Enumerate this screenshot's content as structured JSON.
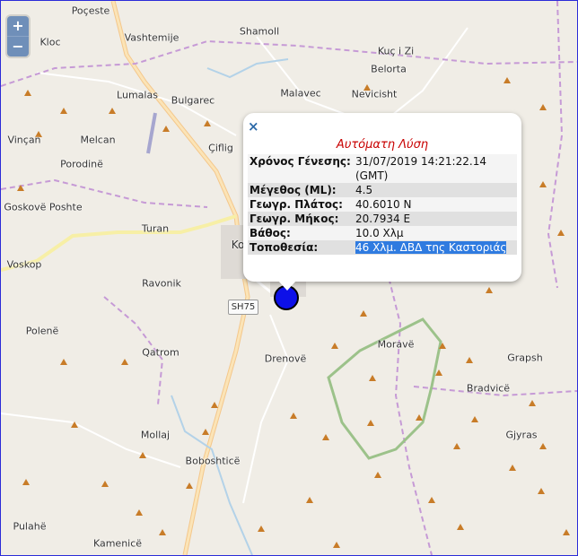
{
  "zoom": {
    "in_label": "+",
    "out_label": "−"
  },
  "road_shield": "SH75",
  "places": [
    {
      "id": "poceste",
      "label": "Poçeste"
    },
    {
      "id": "kloc",
      "label": "Kloc"
    },
    {
      "id": "vashtemije",
      "label": "Vashtemije"
    },
    {
      "id": "shamoll",
      "label": "Shamoll"
    },
    {
      "id": "kuc-i-zi",
      "label": "Kuç i Zi"
    },
    {
      "id": "belorta",
      "label": "Belorta"
    },
    {
      "id": "lumalas",
      "label": "Lumalas"
    },
    {
      "id": "bulgarec",
      "label": "Bulgarec"
    },
    {
      "id": "malavec",
      "label": "Malavec"
    },
    {
      "id": "nevicisht",
      "label": "Nevicisht"
    },
    {
      "id": "vincan",
      "label": "Vinçan"
    },
    {
      "id": "melcan",
      "label": "Melcan"
    },
    {
      "id": "ciflig",
      "label": "Çiflig"
    },
    {
      "id": "porodine",
      "label": "Porodinë"
    },
    {
      "id": "goskove",
      "label": "Goskovë Poshte"
    },
    {
      "id": "turan",
      "label": "Turan"
    },
    {
      "id": "korce",
      "label": "Ko"
    },
    {
      "id": "voskop",
      "label": "Voskop"
    },
    {
      "id": "ravonik",
      "label": "Ravonik"
    },
    {
      "id": "polene",
      "label": "Polenë"
    },
    {
      "id": "qatrom",
      "label": "Qatrom"
    },
    {
      "id": "morave",
      "label": "Moravë"
    },
    {
      "id": "drenove",
      "label": "Drenovë"
    },
    {
      "id": "grapsh",
      "label": "Grapsh"
    },
    {
      "id": "bradvice",
      "label": "Bradvicë"
    },
    {
      "id": "mollaj",
      "label": "Mollaj"
    },
    {
      "id": "gjyras",
      "label": "Gjyras"
    },
    {
      "id": "boboshtice",
      "label": "Boboshticë"
    },
    {
      "id": "pulahe",
      "label": "Pulahë"
    },
    {
      "id": "kamenice",
      "label": "Kamenicë"
    }
  ],
  "popup": {
    "close_label": "×",
    "title": "Αυτόματη Λύση",
    "rows": [
      {
        "key": "Χρόνος Γένεσης:",
        "value": "31/07/2019 14:21:22.14",
        "value2": "(GMT)"
      },
      {
        "key": "Μέγεθος (ML):",
        "value": "4.5"
      },
      {
        "key": "Γεωγρ. Πλάτος:",
        "value": "40.6010 N"
      },
      {
        "key": "Γεωγρ. Μήκος:",
        "value": "20.7934 E"
      },
      {
        "key": "Βάθος:",
        "value": "10.0 Χλμ"
      },
      {
        "key": "Τοποθεσία:",
        "value": "46 Χλμ. ΔΒΔ της Καστοριάς"
      }
    ]
  },
  "colors": {
    "marker": "#0d10e8",
    "popup_title": "#c80000",
    "selection": "#2f7be0"
  }
}
